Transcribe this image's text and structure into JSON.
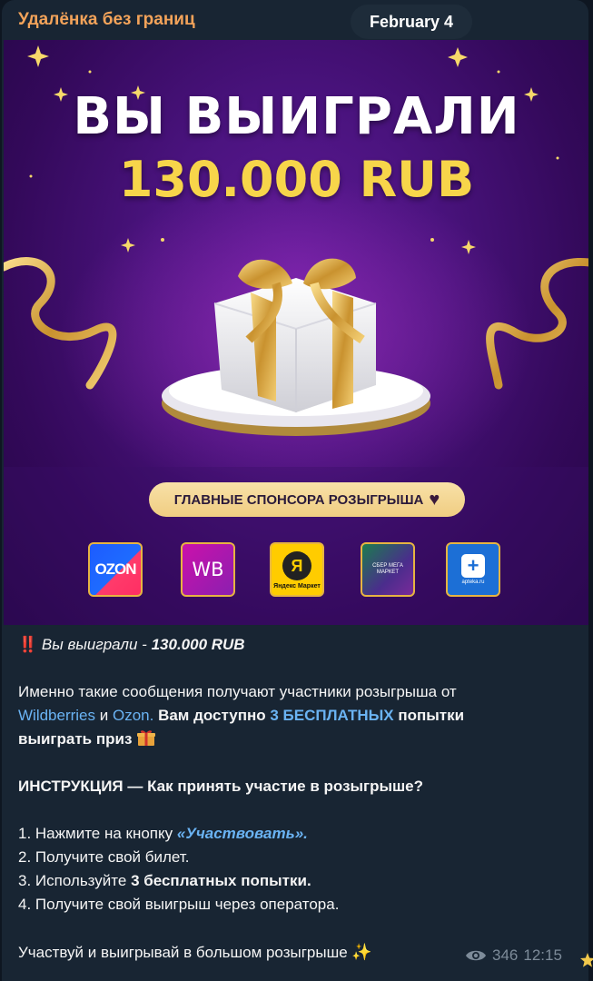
{
  "channel": {
    "name": "Удалёнка без границ"
  },
  "date_label": "February 4",
  "promo": {
    "headline": "ВЫ ВЫИГРАЛИ",
    "amount": "130.000 RUB",
    "sponsors_label": "ГЛАВНЫЕ СПОНСОРА РОЗЫГРЫША",
    "logos": {
      "ozon": "OZON",
      "wb": "WB",
      "ym_symbol": "Я",
      "ym_text": "Яндекс Маркет",
      "sber": "СБЕР МЕГА МАРКЕТ",
      "apteka": "apteka.ru"
    }
  },
  "message": {
    "line1_emoji": "‼️",
    "line1_text": "Вы выиграли - ",
    "line1_amount": "130.000 RUB",
    "p1_a": "Именно такие сообщения получают участники розыгрыша от",
    "p1_link_wb": "Wildberries",
    "p1_and": " и ",
    "p1_link_ozon": "Ozon.",
    "p1_b": " Вам доступно ",
    "p1_link_free": "3 БЕСПЛАТНЫХ",
    "p1_c": " попытки",
    "p1_d": "выиграть приз",
    "instruction_title": "ИНСТРУКЦИЯ — Как принять участие в розыгрыше?",
    "step1_a": "1. Нажмите на кнопку ",
    "step1_link": "«Участвовать».",
    "step2": "2. Получите свой билет.",
    "step3_a": "3. Используйте ",
    "step3_b": "3 бесплатных попытки.",
    "step4": "4. Получите свой выигрыш через оператора.",
    "closing": "Участвуй и выигрывай в большом розыгрыше",
    "closing_emoji": "✨"
  },
  "meta": {
    "views": "346",
    "time": "12:15"
  },
  "colors": {
    "background": "#0e1621",
    "bubble": "#182533",
    "channel_name": "#f3a35a",
    "link": "#6ab3f3",
    "meta": "#7d8b99",
    "gold": "#f7d54a"
  }
}
